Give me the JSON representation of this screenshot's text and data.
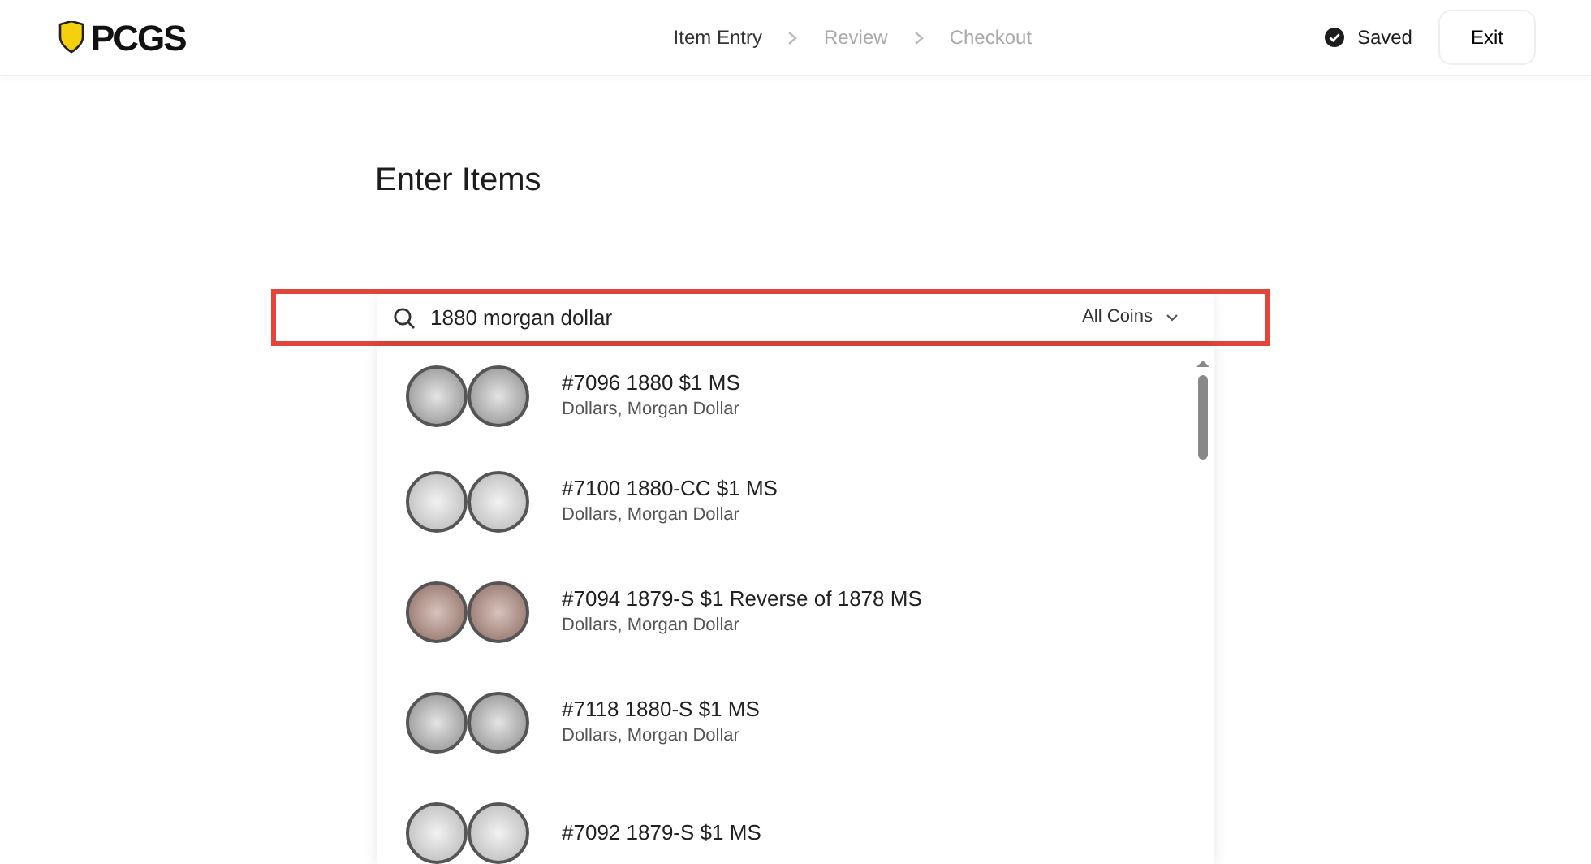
{
  "header": {
    "logo": "PCGS",
    "steps": [
      {
        "label": "Item Entry",
        "selected": true
      },
      {
        "label": "Review",
        "selected": false
      },
      {
        "label": "Checkout",
        "selected": false
      }
    ],
    "save_status": "Saved",
    "exit_button": "Exit"
  },
  "title": "Enter Items",
  "search": {
    "value": "1880 morgan dollar",
    "highlighted": true,
    "filter": "All Coins"
  },
  "results": [
    {
      "title": "#7096 1880 $1 MS",
      "subtitle": "Dollars, Morgan Dollar",
      "kind": "silver"
    },
    {
      "title": "#7100 1880-CC $1 MS",
      "subtitle": "Dollars, Morgan Dollar",
      "kind": "bright"
    },
    {
      "title": "#7094 1879-S $1 Reverse of 1878 MS",
      "subtitle": "Dollars, Morgan Dollar",
      "kind": "toned"
    },
    {
      "title": "#7118 1880-S $1 MS",
      "subtitle": "Dollars, Morgan Dollar",
      "kind": "silver"
    },
    {
      "title": "#7092 1879-S $1 MS",
      "kind": "bright"
    }
  ]
}
